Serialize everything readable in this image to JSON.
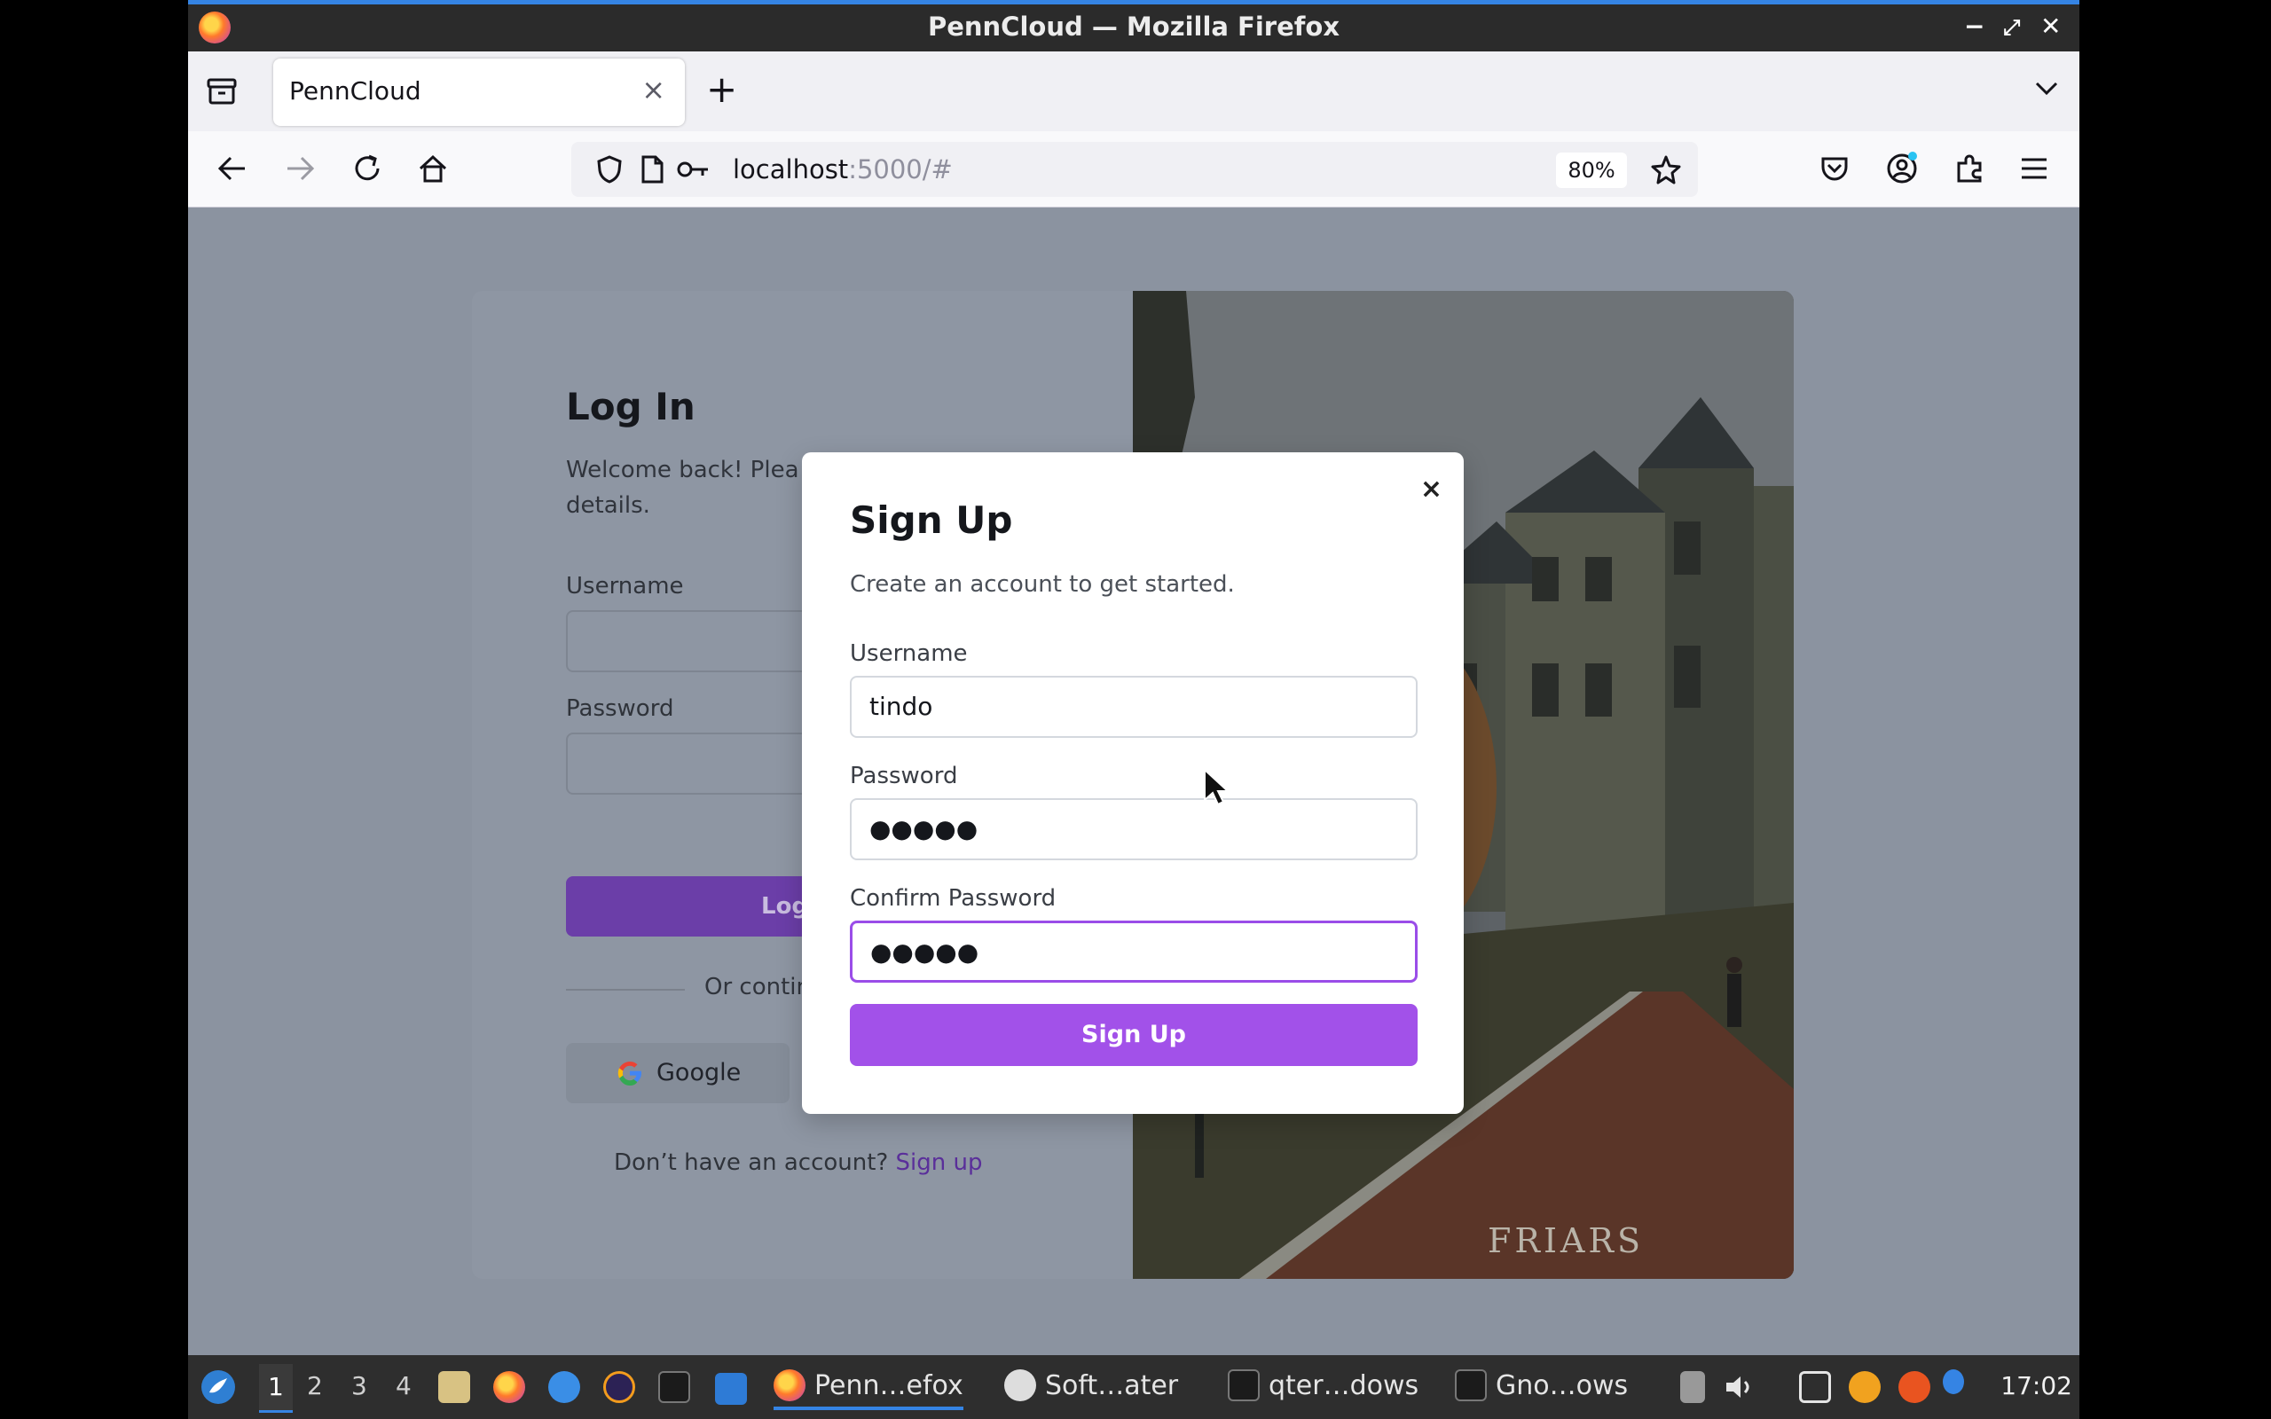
{
  "window": {
    "title": "PennCloud — Mozilla Firefox",
    "minimize": "−",
    "maximize": "⤢",
    "close": "✕"
  },
  "tabs": {
    "active_tab_label": "PennCloud",
    "close_glyph": "×",
    "new_tab_glyph": "+"
  },
  "navbar": {
    "url_host": "localhost",
    "url_rest": ":5000/#",
    "zoom": "80%"
  },
  "login": {
    "title": "Log In",
    "subtitle": "Welcome back! Plea",
    "subtitle_line2": "details.",
    "username_label": "Username",
    "password_label": "Password",
    "login_button": "Log",
    "or_text": "Or contin",
    "google_label": "Google",
    "signup_prompt": "Don’t have an account?",
    "signup_link": "Sign up"
  },
  "modal": {
    "close_glyph": "×",
    "title": "Sign Up",
    "subtitle": "Create an account to get started.",
    "username_label": "Username",
    "username_value": "tindo",
    "password_label": "Password",
    "password_value": "●●●●●",
    "confirm_label": "Confirm Password",
    "confirm_value": "●●●●●",
    "submit_label": "Sign Up"
  },
  "photo": {
    "chalk_text": "FRIARS"
  },
  "taskbar": {
    "workspaces": [
      "1",
      "2",
      "3",
      "4"
    ],
    "windows": [
      {
        "label": "Penn…efox"
      },
      {
        "label": "Soft…ater"
      },
      {
        "label": "qter…dows"
      },
      {
        "label": "Gno…ows"
      }
    ],
    "clock": "17:02"
  },
  "colors": {
    "accent": "#a251e9",
    "brand_link": "#5a2f9a",
    "titlebar": "#2b2b2b",
    "taskbar": "#2e2e2e"
  }
}
